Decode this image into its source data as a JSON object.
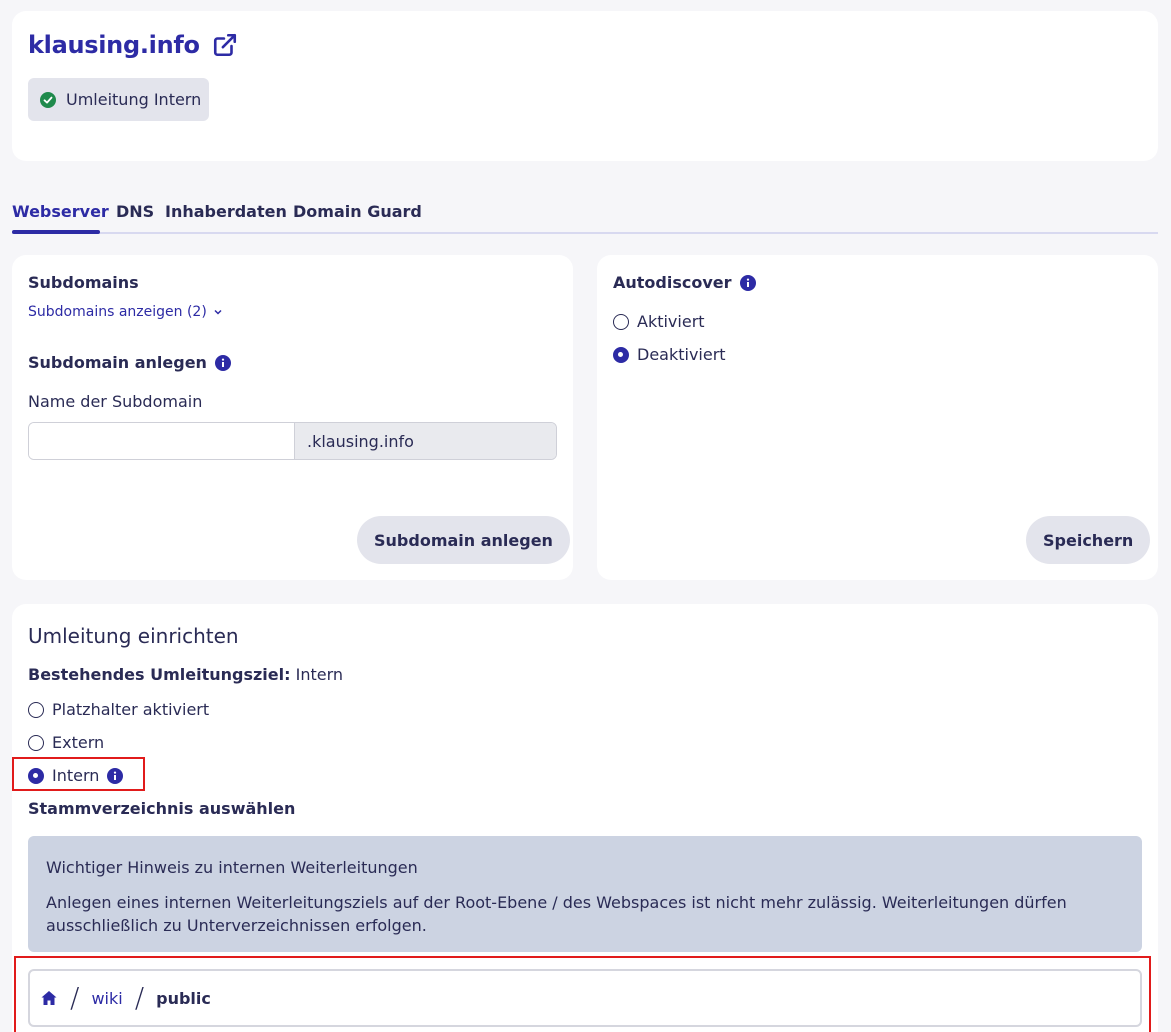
{
  "header": {
    "domain": "klausing.info",
    "status_badge": "Umleitung Intern"
  },
  "tabs": [
    {
      "label": "Webserver",
      "active": true
    },
    {
      "label": "DNS",
      "active": false
    },
    {
      "label": "Inhaberdaten",
      "active": false
    },
    {
      "label": "Domain Guard",
      "active": false
    }
  ],
  "subdomains": {
    "title": "Subdomains",
    "show_link": "Subdomains anzeigen (2)",
    "create_title": "Subdomain anlegen",
    "name_label": "Name der Subdomain",
    "name_value": "",
    "suffix": ".klausing.info",
    "create_button": "Subdomain anlegen"
  },
  "autodiscover": {
    "title": "Autodiscover",
    "options": [
      {
        "label": "Aktiviert",
        "checked": false
      },
      {
        "label": "Deaktiviert",
        "checked": true
      }
    ],
    "save_button": "Speichern"
  },
  "redirect": {
    "title": "Umleitung einrichten",
    "existing_label": "Bestehendes Umleitungsziel:",
    "existing_value": "Intern",
    "options": [
      {
        "label": "Platzhalter aktiviert",
        "checked": false
      },
      {
        "label": "Extern",
        "checked": false
      },
      {
        "label": "Intern",
        "checked": true
      }
    ],
    "root_dir_label": "Stammverzeichnis auswählen",
    "notice_title": "Wichtiger Hinweis zu internen Weiterleitungen",
    "notice_text": "Anlegen eines internen Weiterleitungsziels auf der Root-Ebene / des Webspaces ist nicht mehr zulässig. Weiterleitungen dürfen ausschließlich zu Unterverzeichnissen erfolgen.",
    "path": [
      "wiki",
      "public"
    ]
  },
  "colors": {
    "accent": "#2d2ba5",
    "text": "#2a2b55",
    "success": "#1f8a4c",
    "highlight": "#e11b1b",
    "notice_bg": "#ccd3e2"
  }
}
